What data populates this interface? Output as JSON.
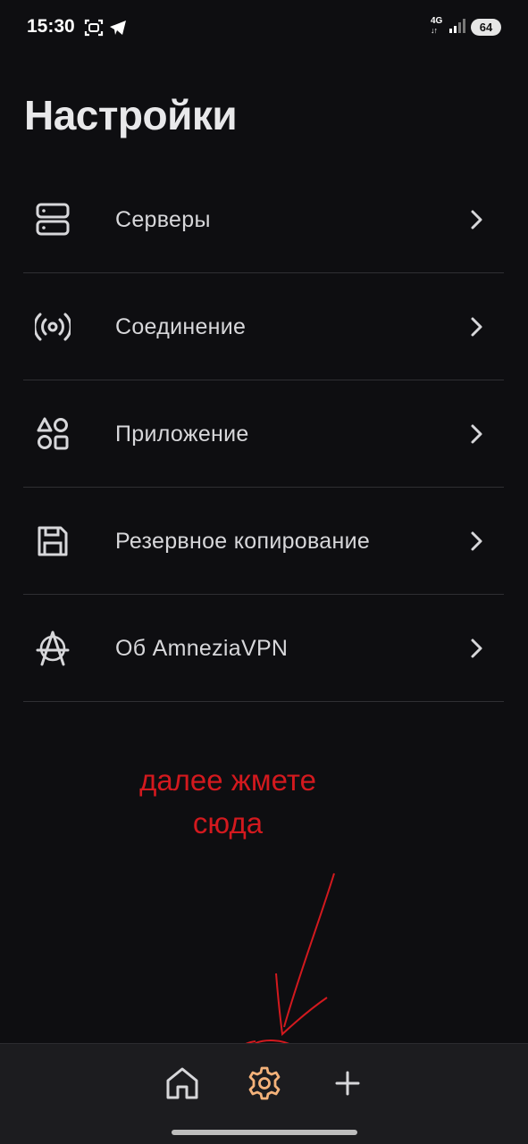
{
  "status_bar": {
    "time": "15:30",
    "network": "4G",
    "battery": "64"
  },
  "page": {
    "title": "Настройки"
  },
  "menu": {
    "items": [
      {
        "label": "Серверы",
        "icon": "servers-icon"
      },
      {
        "label": "Соединение",
        "icon": "connection-icon"
      },
      {
        "label": "Приложение",
        "icon": "app-shapes-icon"
      },
      {
        "label": "Резервное копирование",
        "icon": "floppy-disk-icon"
      },
      {
        "label": "Об AmneziaVPN",
        "icon": "amnezia-logo-icon"
      }
    ]
  },
  "annotation": {
    "line1": "далее жмете",
    "line2": "сюда",
    "color": "#d3191e"
  },
  "bottom_nav": {
    "items": [
      "home-icon",
      "settings-gear-icon",
      "plus-icon"
    ],
    "active": "settings-gear-icon",
    "active_color": "#f4b27a"
  },
  "colors": {
    "background": "#0e0e11",
    "text": "#d7d7da",
    "divider": "#2f2f33"
  }
}
